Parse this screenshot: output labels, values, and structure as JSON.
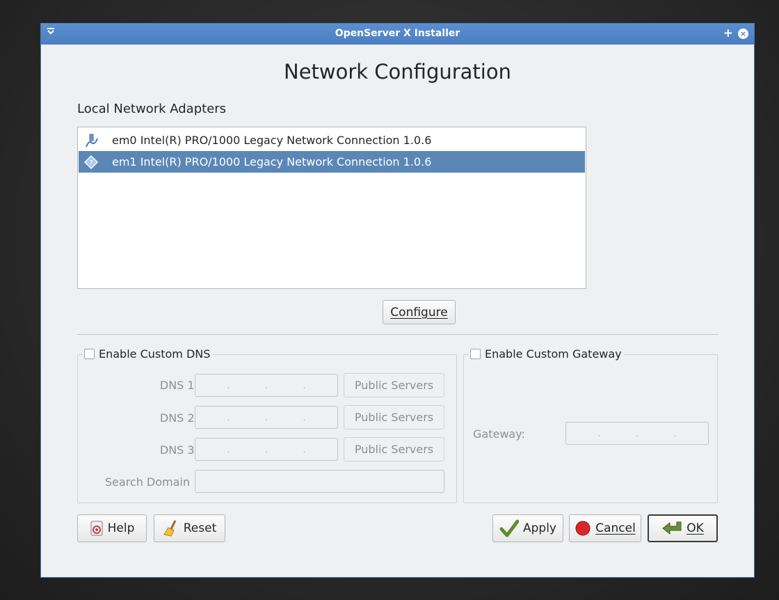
{
  "window": {
    "title": "OpenServer X Installer",
    "menu_icon": "chevron-down-menu-icon",
    "plus_icon": "+",
    "close_icon": "×"
  },
  "page": {
    "heading": "Network Configuration",
    "adapters_label": "Local Network Adapters"
  },
  "adapters": [
    {
      "name": "em0",
      "description": "em0  Intel(R) PRO/1000 Legacy Network Connection 1.0.6",
      "selected": false,
      "icon": "network-wired-icon"
    },
    {
      "name": "em1",
      "description": "em1  Intel(R) PRO/1000 Legacy Network Connection 1.0.6",
      "selected": true,
      "icon": "network-unknown-icon"
    }
  ],
  "buttons": {
    "configure": "Configure",
    "help": "Help",
    "reset": "Reset",
    "apply": "Apply",
    "cancel": "Cancel",
    "ok": "OK"
  },
  "dns": {
    "enable_label": "Enable Custom DNS",
    "checked": false,
    "dns1_label": "DNS 1:",
    "dns2_label": "DNS 2:",
    "dns3_label": "DNS 3:",
    "search_domain_label": "Search Domain",
    "public_servers": "Public Servers",
    "dns1_value": "",
    "dns2_value": "",
    "dns3_value": "",
    "search_domain_value": ""
  },
  "gateway": {
    "enable_label": "Enable Custom Gateway",
    "checked": false,
    "gateway_label": "Gateway:",
    "gateway_value": ""
  },
  "colors": {
    "titlebar": "#4a7fc2",
    "selection": "#5a87b6",
    "window_bg": "#eff0f1"
  }
}
